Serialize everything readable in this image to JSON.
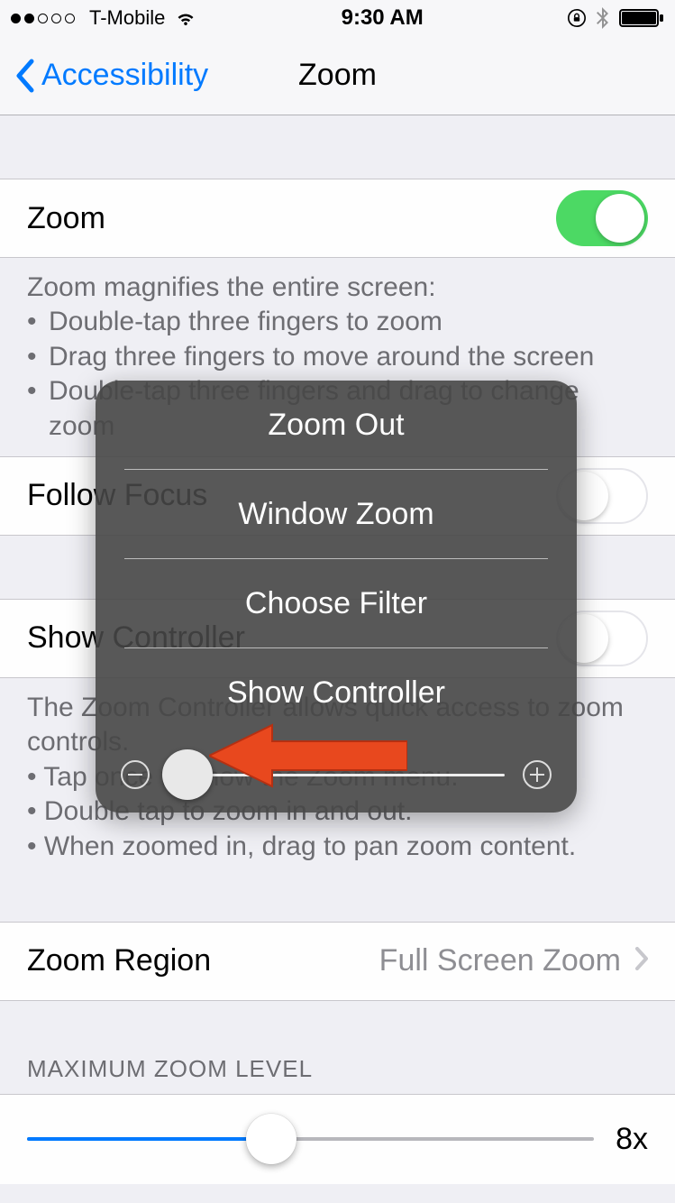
{
  "status": {
    "carrier": "T-Mobile",
    "time": "9:30 AM"
  },
  "nav": {
    "back_label": "Accessibility",
    "title": "Zoom"
  },
  "cells": {
    "zoom_label": "Zoom",
    "follow_focus_label": "Follow Focus",
    "show_controller_label": "Show Controller",
    "zoom_region_label": "Zoom Region",
    "zoom_region_value": "Full Screen Zoom"
  },
  "footers": {
    "zoom_desc_header": "Zoom magnifies the entire screen:",
    "zoom_desc_b1": "Double-tap three fingers to zoom",
    "zoom_desc_b2": "Drag three fingers to move around the screen",
    "zoom_desc_b3": "Double-tap three fingers and drag to change zoom",
    "controller_desc_line1": "The Zoom Controller allows quick access to zoom controls.",
    "controller_desc_b1": "Tap once to show the Zoom menu.",
    "controller_desc_b2": "Double tap to zoom in and out.",
    "controller_desc_b3": "When zoomed in, drag to pan zoom content."
  },
  "max_zoom": {
    "header": "MAXIMUM ZOOM LEVEL",
    "value": "8x"
  },
  "popover": {
    "item1": "Zoom Out",
    "item2": "Window Zoom",
    "item3": "Choose Filter",
    "item4": "Show Controller"
  }
}
